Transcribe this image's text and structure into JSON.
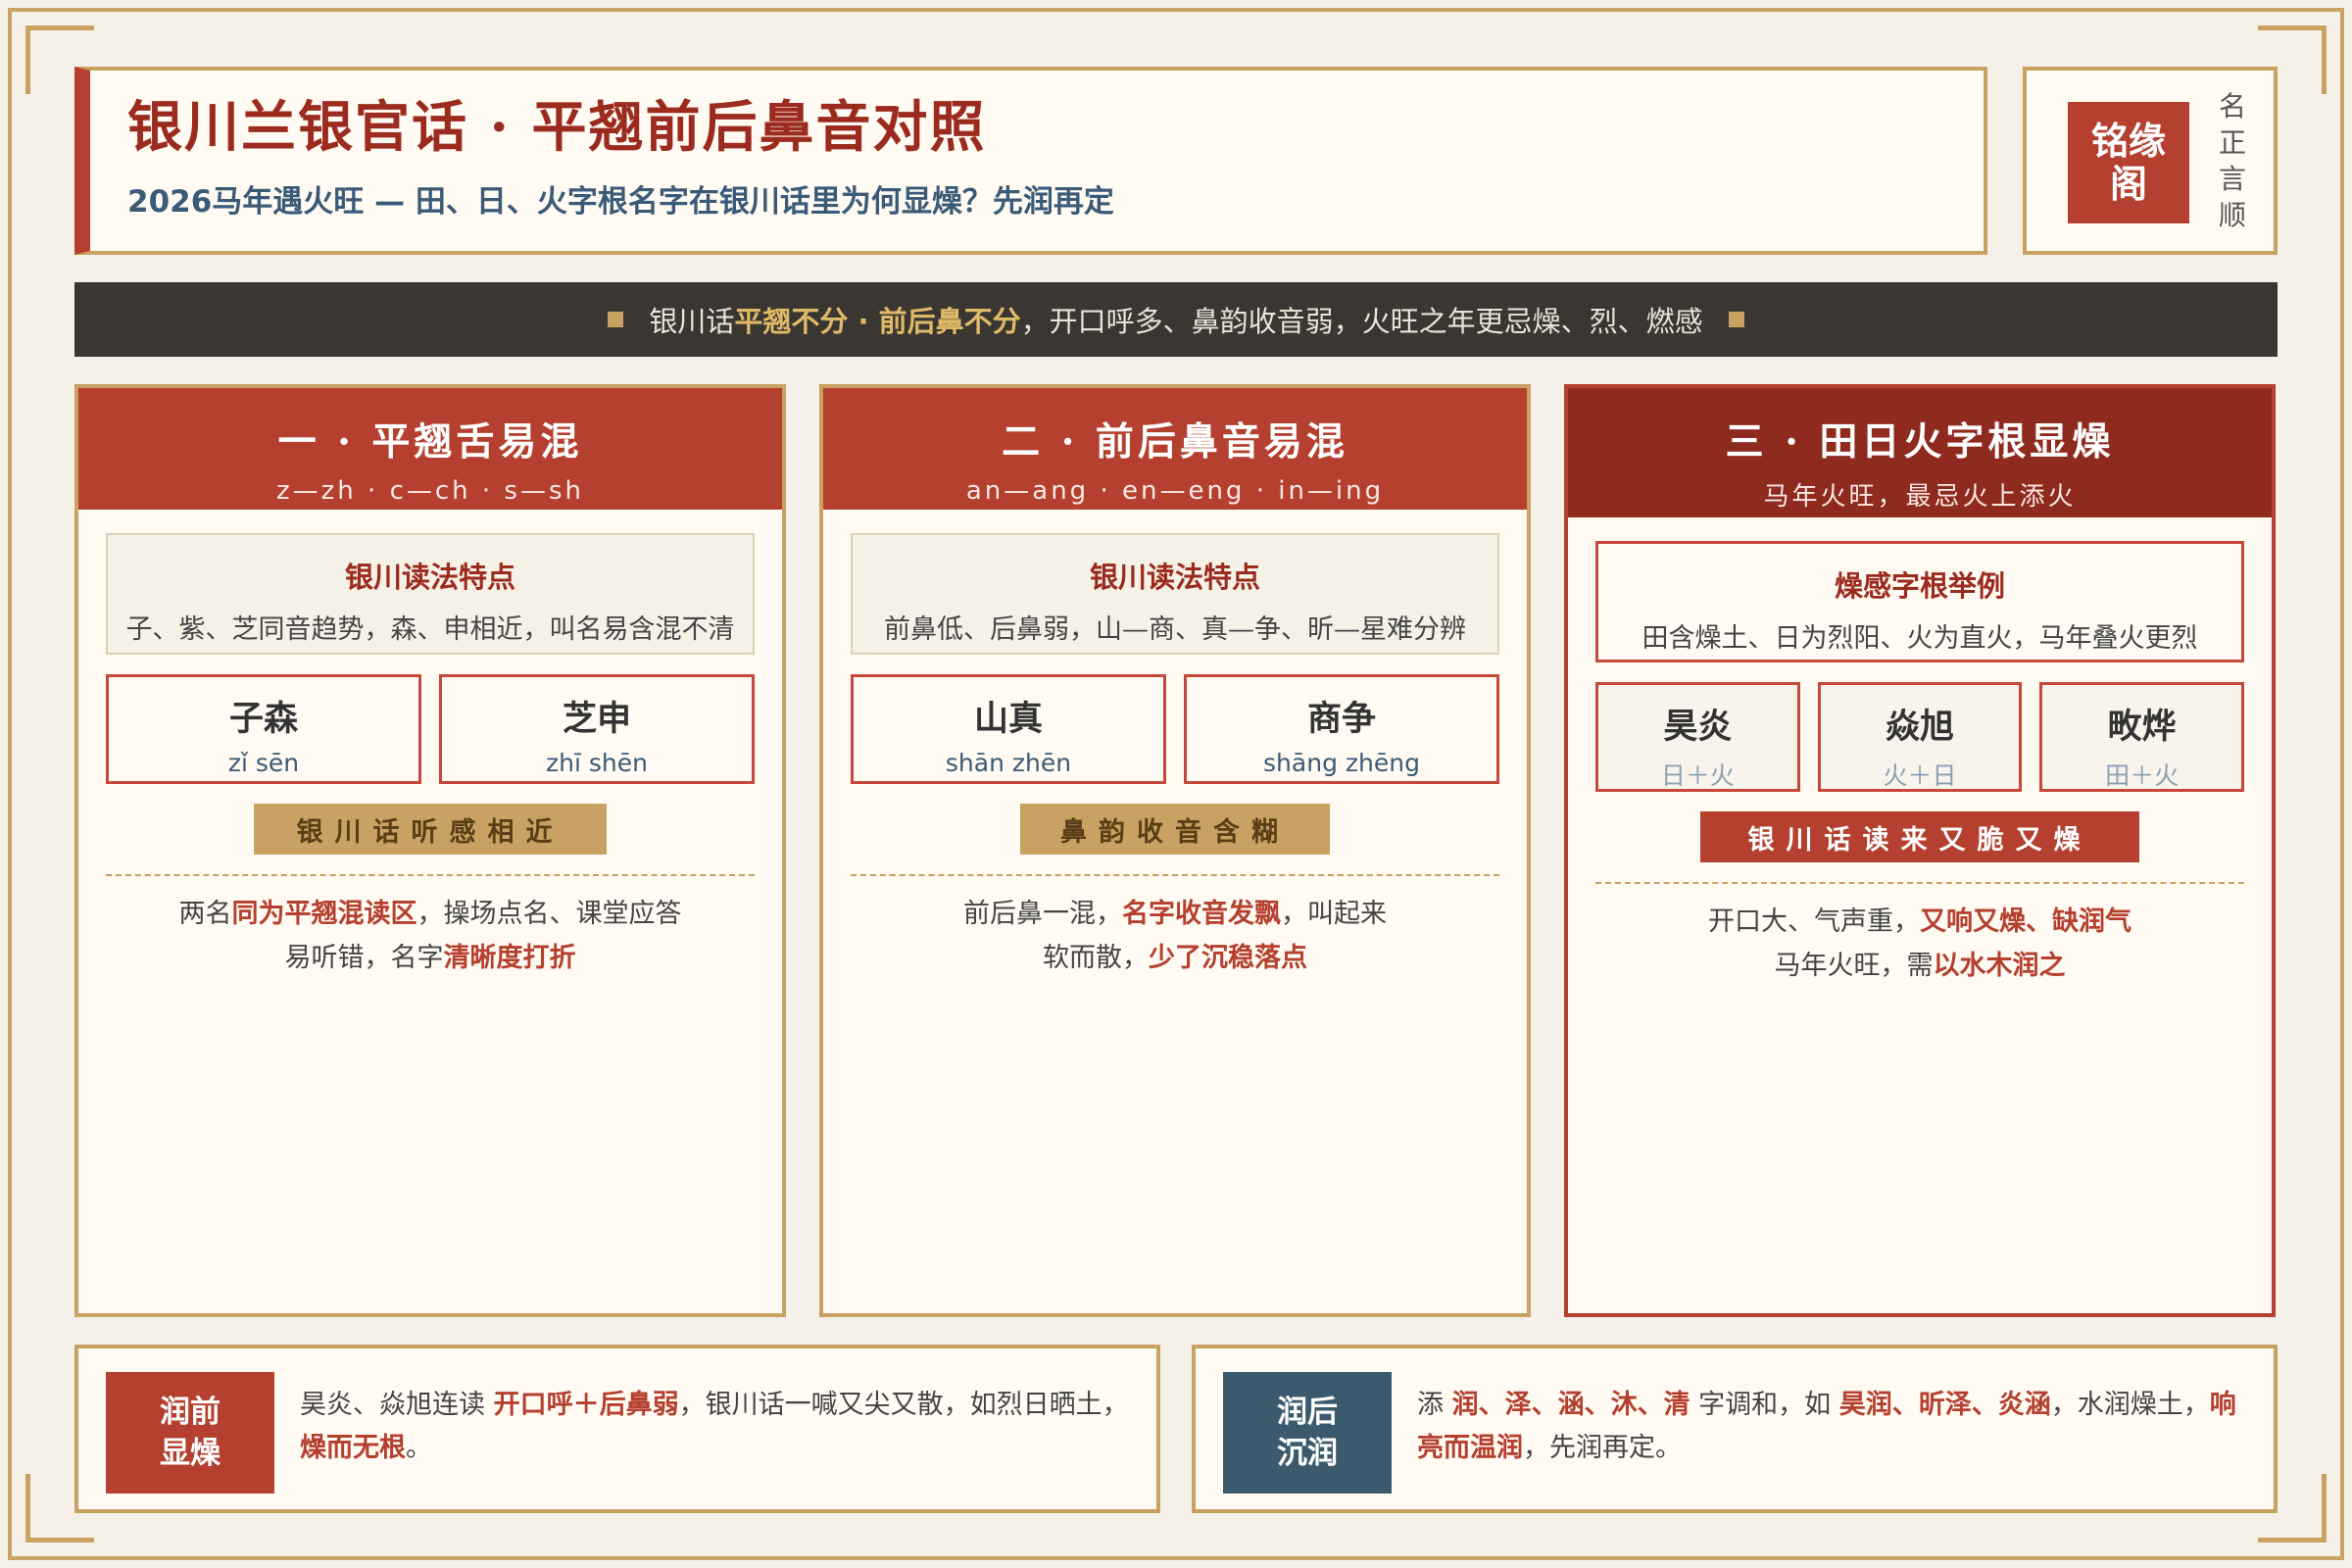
{
  "header": {
    "title": "银川兰银官话 · 平翘前后鼻音对照",
    "subtitle": "2026马年遇火旺 — 田、日、火字根名字在银川话里为何显燥？先润再定",
    "logo_line1": "铭缘",
    "logo_line2": "阁",
    "motto": [
      "名",
      "正",
      "言",
      "顺"
    ]
  },
  "banner": {
    "prefix": "银川话 ",
    "highlight": "平翘不分 · 前后鼻不分",
    "suffix": "，开口呼多、鼻韵收音弱，火旺之年更忌燥、烈、燃感"
  },
  "columns": [
    {
      "title": "一 · 平翘舌易混",
      "subtitle": "z—zh · c—ch · s—sh",
      "feature_title": "银川读法特点",
      "feature_text": "子、紫、芝同音趋势，森、申相近，叫名易含混不清",
      "names": [
        {
          "name": "子森",
          "pinyin": "zǐ sēn"
        },
        {
          "name": "芝申",
          "pinyin": "zhī shēn"
        }
      ],
      "tag": "银川话听感相近",
      "note_line1_a": "两名",
      "note_line1_red": "同为平翘混读区",
      "note_line1_b": "，操场点名、课堂应答",
      "note_line2_a": "易听错，名字",
      "note_line2_red": "清晰度打折",
      "note_line2_b": ""
    },
    {
      "title": "二 · 前后鼻音易混",
      "subtitle": "an—ang · en—eng · in—ing",
      "feature_title": "银川读法特点",
      "feature_text": "前鼻低、后鼻弱，山—商、真—争、昕—星难分辨",
      "names": [
        {
          "name": "山真",
          "pinyin": "shān zhēn"
        },
        {
          "name": "商争",
          "pinyin": "shāng zhēng"
        }
      ],
      "tag": "鼻韵收音含糊",
      "note_line1_a": "前后鼻一混，",
      "note_line1_red": "名字收音发飘",
      "note_line1_b": "，叫起来",
      "note_line2_a": "软而散，",
      "note_line2_red": "少了沉稳落点",
      "note_line2_b": ""
    },
    {
      "title": "三 · 田日火字根显燥",
      "subtitle": "马年火旺，最忌火上添火",
      "feature_title": "燥感字根举例",
      "feature_text": "田含燥土、日为烈阳、火为直火，马年叠火更烈",
      "names": [
        {
          "name": "昊炎",
          "pinyin": "日＋火"
        },
        {
          "name": "焱旭",
          "pinyin": "火＋日"
        },
        {
          "name": "畋烨",
          "pinyin": "田＋火"
        }
      ],
      "tag": "银川话读来又脆又燥",
      "note_line1_a": "开口大、气声重，",
      "note_line1_red": "又响又燥、缺润气",
      "note_line1_b": "",
      "note_line2_a": "马年火旺，需",
      "note_line2_red": "以水木润之",
      "note_line2_b": ""
    }
  ],
  "bottom": {
    "before_label_1": "润前",
    "before_label_2": "显燥",
    "before_text_a": "昊炎、焱旭连读 ",
    "before_text_red1": "开口呼＋后鼻弱",
    "before_text_b": "，银川话一喊又尖又散，如烈日晒土，",
    "before_text_red2": "燥而无根",
    "before_text_c": "。",
    "after_label_1": "润后",
    "after_label_2": "沉润",
    "after_text_a": "添 ",
    "after_text_red1": "润、泽、涵、沐、清",
    "after_text_b": " 字调和，如 ",
    "after_text_red2": "昊润、昕泽、炎涵",
    "after_text_c": "，水润燥土，",
    "after_text_red3": "响亮而温润",
    "after_text_d": "，先润再定。"
  },
  "colors": {
    "accent_red": "#b5402f",
    "dark_red": "#8f2a1f",
    "gold": "#c9a163",
    "navy": "#3b5a78",
    "banner_bg": "#3a3733",
    "paper": "#fffbf3"
  }
}
